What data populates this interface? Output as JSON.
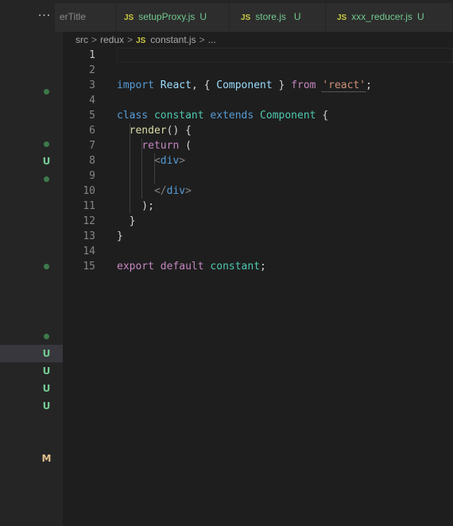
{
  "explorer": {
    "more_actions": "···",
    "status_badges": [
      {
        "kind": "dot",
        "label": ""
      },
      {
        "kind": "dot",
        "label": ""
      },
      {
        "kind": "untracked",
        "label": "U"
      },
      {
        "kind": "dot",
        "label": ""
      },
      {
        "kind": "dot",
        "label": ""
      },
      {
        "kind": "dot",
        "label": ""
      },
      {
        "kind": "untracked",
        "label": "U"
      },
      {
        "kind": "untracked",
        "label": "U"
      },
      {
        "kind": "untracked",
        "label": "U"
      },
      {
        "kind": "untracked",
        "label": "U"
      },
      {
        "kind": "modified",
        "label": "M"
      }
    ]
  },
  "tabs": [
    {
      "icon": "JS",
      "label": "erTitle",
      "status": ""
    },
    {
      "icon": "JS",
      "label": "setupProxy.js",
      "status": "U"
    },
    {
      "icon": "JS",
      "label": "store.js",
      "status": "U"
    },
    {
      "icon": "JS",
      "label": "xxx_reducer.js",
      "status": "U"
    }
  ],
  "breadcrumb": {
    "parts": [
      "src",
      "redux"
    ],
    "file_icon": "JS",
    "file": "constant.js",
    "tail": "..."
  },
  "editor": {
    "current_line": 1,
    "lines": [
      {
        "n": "1",
        "tokens": []
      },
      {
        "n": "2",
        "tokens": []
      },
      {
        "n": "3",
        "tokens": [
          [
            "kw",
            "import"
          ],
          [
            "t",
            " "
          ],
          [
            "var",
            "React"
          ],
          [
            "t",
            ", { "
          ],
          [
            "var",
            "Component"
          ],
          [
            "t",
            " } "
          ],
          [
            "ctrl",
            "from"
          ],
          [
            "t",
            " "
          ],
          [
            "str",
            "'react'"
          ],
          [
            "t",
            ";"
          ]
        ]
      },
      {
        "n": "4",
        "tokens": []
      },
      {
        "n": "5",
        "tokens": [
          [
            "kw",
            "class"
          ],
          [
            "t",
            " "
          ],
          [
            "cls",
            "constant"
          ],
          [
            "t",
            " "
          ],
          [
            "kw",
            "extends"
          ],
          [
            "t",
            " "
          ],
          [
            "cls",
            "Component"
          ],
          [
            "t",
            " {"
          ]
        ]
      },
      {
        "n": "6",
        "tokens": [
          [
            "t",
            "  "
          ],
          [
            "fn",
            "render"
          ],
          [
            "t",
            "() {"
          ]
        ]
      },
      {
        "n": "7",
        "tokens": [
          [
            "t",
            "    "
          ],
          [
            "ctrl",
            "return"
          ],
          [
            "t",
            " ("
          ]
        ]
      },
      {
        "n": "8",
        "tokens": [
          [
            "t",
            "      "
          ],
          [
            "pun",
            "<"
          ],
          [
            "tag",
            "div"
          ],
          [
            "pun",
            ">"
          ]
        ]
      },
      {
        "n": "9",
        "tokens": []
      },
      {
        "n": "10",
        "tokens": [
          [
            "t",
            "      "
          ],
          [
            "pun",
            "</"
          ],
          [
            "tag",
            "div"
          ],
          [
            "pun",
            ">"
          ]
        ]
      },
      {
        "n": "11",
        "tokens": [
          [
            "t",
            "    );"
          ]
        ]
      },
      {
        "n": "12",
        "tokens": [
          [
            "t",
            "  }"
          ]
        ]
      },
      {
        "n": "13",
        "tokens": [
          [
            "t",
            "}"
          ]
        ]
      },
      {
        "n": "14",
        "tokens": []
      },
      {
        "n": "15",
        "tokens": [
          [
            "ctrl",
            "export"
          ],
          [
            "t",
            " "
          ],
          [
            "ctrl",
            "default"
          ],
          [
            "t",
            " "
          ],
          [
            "cls",
            "constant"
          ],
          [
            "t",
            ";"
          ]
        ]
      }
    ]
  },
  "colors": {
    "editor_bg": "#1e1e1e",
    "sidebar_bg": "#252526",
    "untracked": "#73c991",
    "modified": "#e2c08d",
    "js_icon": "#cbcb41"
  }
}
